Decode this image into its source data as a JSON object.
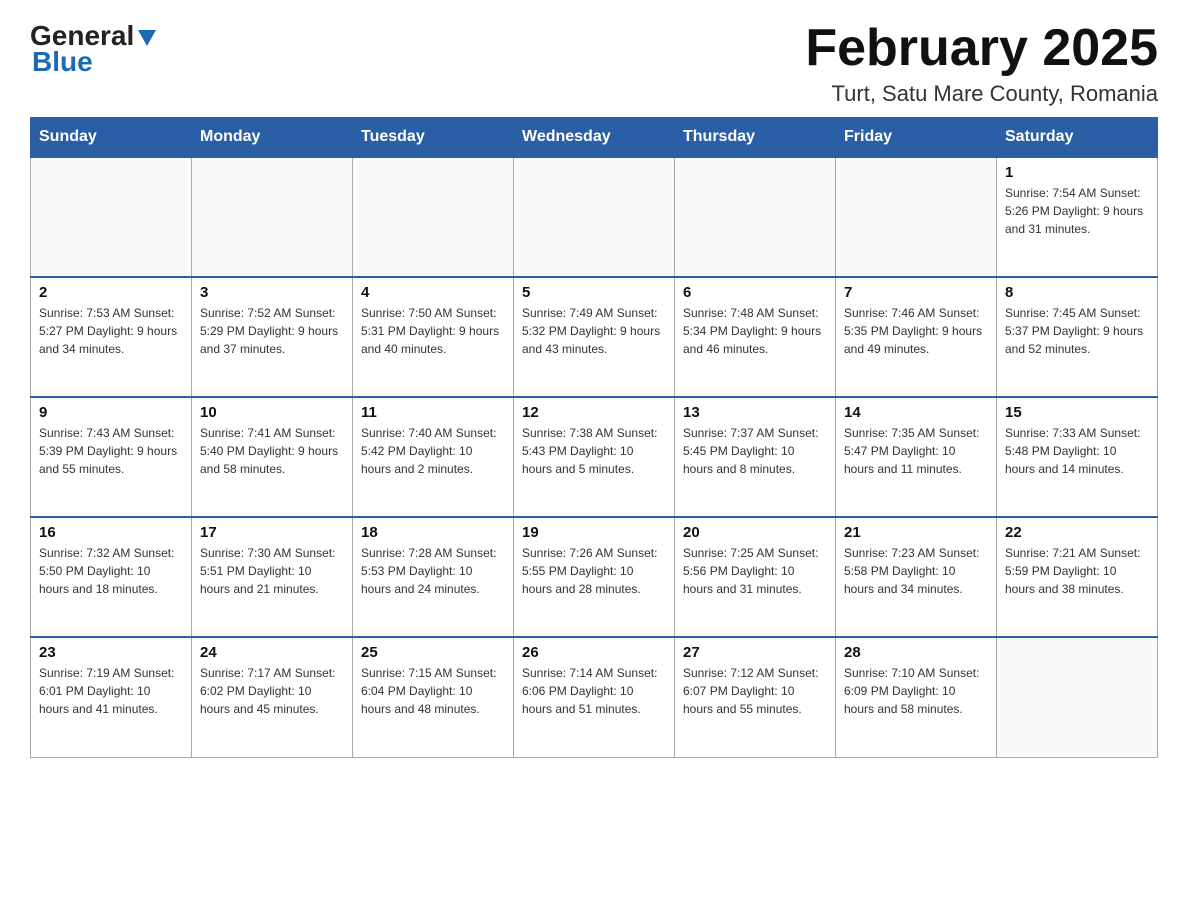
{
  "header": {
    "logo": {
      "general": "General",
      "blue": "Blue"
    },
    "title": "February 2025",
    "location": "Turt, Satu Mare County, Romania"
  },
  "days_of_week": [
    "Sunday",
    "Monday",
    "Tuesday",
    "Wednesday",
    "Thursday",
    "Friday",
    "Saturday"
  ],
  "weeks": [
    [
      {
        "day": "",
        "info": ""
      },
      {
        "day": "",
        "info": ""
      },
      {
        "day": "",
        "info": ""
      },
      {
        "day": "",
        "info": ""
      },
      {
        "day": "",
        "info": ""
      },
      {
        "day": "",
        "info": ""
      },
      {
        "day": "1",
        "info": "Sunrise: 7:54 AM\nSunset: 5:26 PM\nDaylight: 9 hours and 31 minutes."
      }
    ],
    [
      {
        "day": "2",
        "info": "Sunrise: 7:53 AM\nSunset: 5:27 PM\nDaylight: 9 hours and 34 minutes."
      },
      {
        "day": "3",
        "info": "Sunrise: 7:52 AM\nSunset: 5:29 PM\nDaylight: 9 hours and 37 minutes."
      },
      {
        "day": "4",
        "info": "Sunrise: 7:50 AM\nSunset: 5:31 PM\nDaylight: 9 hours and 40 minutes."
      },
      {
        "day": "5",
        "info": "Sunrise: 7:49 AM\nSunset: 5:32 PM\nDaylight: 9 hours and 43 minutes."
      },
      {
        "day": "6",
        "info": "Sunrise: 7:48 AM\nSunset: 5:34 PM\nDaylight: 9 hours and 46 minutes."
      },
      {
        "day": "7",
        "info": "Sunrise: 7:46 AM\nSunset: 5:35 PM\nDaylight: 9 hours and 49 minutes."
      },
      {
        "day": "8",
        "info": "Sunrise: 7:45 AM\nSunset: 5:37 PM\nDaylight: 9 hours and 52 minutes."
      }
    ],
    [
      {
        "day": "9",
        "info": "Sunrise: 7:43 AM\nSunset: 5:39 PM\nDaylight: 9 hours and 55 minutes."
      },
      {
        "day": "10",
        "info": "Sunrise: 7:41 AM\nSunset: 5:40 PM\nDaylight: 9 hours and 58 minutes."
      },
      {
        "day": "11",
        "info": "Sunrise: 7:40 AM\nSunset: 5:42 PM\nDaylight: 10 hours and 2 minutes."
      },
      {
        "day": "12",
        "info": "Sunrise: 7:38 AM\nSunset: 5:43 PM\nDaylight: 10 hours and 5 minutes."
      },
      {
        "day": "13",
        "info": "Sunrise: 7:37 AM\nSunset: 5:45 PM\nDaylight: 10 hours and 8 minutes."
      },
      {
        "day": "14",
        "info": "Sunrise: 7:35 AM\nSunset: 5:47 PM\nDaylight: 10 hours and 11 minutes."
      },
      {
        "day": "15",
        "info": "Sunrise: 7:33 AM\nSunset: 5:48 PM\nDaylight: 10 hours and 14 minutes."
      }
    ],
    [
      {
        "day": "16",
        "info": "Sunrise: 7:32 AM\nSunset: 5:50 PM\nDaylight: 10 hours and 18 minutes."
      },
      {
        "day": "17",
        "info": "Sunrise: 7:30 AM\nSunset: 5:51 PM\nDaylight: 10 hours and 21 minutes."
      },
      {
        "day": "18",
        "info": "Sunrise: 7:28 AM\nSunset: 5:53 PM\nDaylight: 10 hours and 24 minutes."
      },
      {
        "day": "19",
        "info": "Sunrise: 7:26 AM\nSunset: 5:55 PM\nDaylight: 10 hours and 28 minutes."
      },
      {
        "day": "20",
        "info": "Sunrise: 7:25 AM\nSunset: 5:56 PM\nDaylight: 10 hours and 31 minutes."
      },
      {
        "day": "21",
        "info": "Sunrise: 7:23 AM\nSunset: 5:58 PM\nDaylight: 10 hours and 34 minutes."
      },
      {
        "day": "22",
        "info": "Sunrise: 7:21 AM\nSunset: 5:59 PM\nDaylight: 10 hours and 38 minutes."
      }
    ],
    [
      {
        "day": "23",
        "info": "Sunrise: 7:19 AM\nSunset: 6:01 PM\nDaylight: 10 hours and 41 minutes."
      },
      {
        "day": "24",
        "info": "Sunrise: 7:17 AM\nSunset: 6:02 PM\nDaylight: 10 hours and 45 minutes."
      },
      {
        "day": "25",
        "info": "Sunrise: 7:15 AM\nSunset: 6:04 PM\nDaylight: 10 hours and 48 minutes."
      },
      {
        "day": "26",
        "info": "Sunrise: 7:14 AM\nSunset: 6:06 PM\nDaylight: 10 hours and 51 minutes."
      },
      {
        "day": "27",
        "info": "Sunrise: 7:12 AM\nSunset: 6:07 PM\nDaylight: 10 hours and 55 minutes."
      },
      {
        "day": "28",
        "info": "Sunrise: 7:10 AM\nSunset: 6:09 PM\nDaylight: 10 hours and 58 minutes."
      },
      {
        "day": "",
        "info": ""
      }
    ]
  ]
}
